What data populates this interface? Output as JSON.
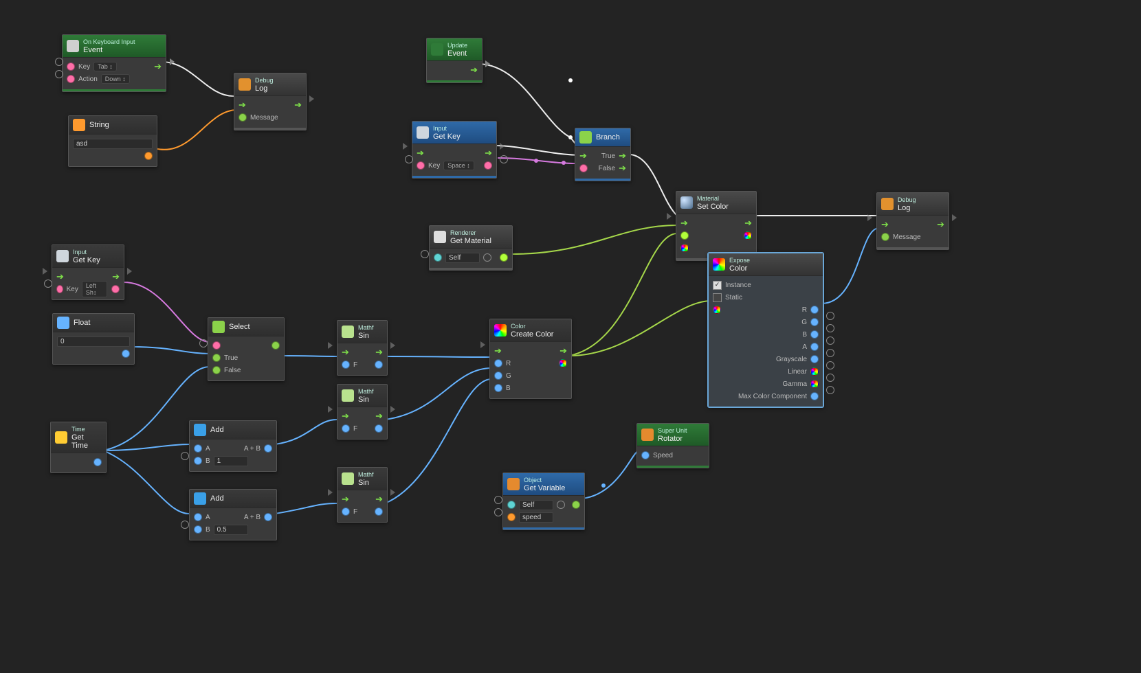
{
  "nodes": {
    "keyboardInput": {
      "sup": "On Keyboard Input",
      "title": "Event",
      "keyLabel": "Key",
      "keyVal": "Tab ↕",
      "actionLabel": "Action",
      "actionVal": "Down ↕"
    },
    "debug1": {
      "sup": "Debug",
      "title": "Log",
      "msg": "Message"
    },
    "string": {
      "title": "String",
      "val": "asd"
    },
    "update": {
      "sup": "Update",
      "title": "Event"
    },
    "getKey1": {
      "sup": "Input",
      "title": "Get Key",
      "keyLabel": "Key",
      "keyVal": "Space ↕"
    },
    "branch": {
      "title": "Branch",
      "t": "True",
      "f": "False"
    },
    "setColor": {
      "sup": "Material",
      "title": "Set Color"
    },
    "debug2": {
      "sup": "Debug",
      "title": "Log",
      "msg": "Message"
    },
    "renderer": {
      "sup": "Renderer",
      "title": "Get Material",
      "self": "Self"
    },
    "expose": {
      "sup": "Expose",
      "title": "Color",
      "instance": "Instance",
      "staticL": "Static",
      "outs": [
        "R",
        "G",
        "B",
        "A",
        "Grayscale",
        "Linear",
        "Gamma",
        "Max Color Component"
      ]
    },
    "getKey2": {
      "sup": "Input",
      "title": "Get Key",
      "keyLabel": "Key",
      "keyVal": "Left Sh↕"
    },
    "float": {
      "title": "Float",
      "val": "0"
    },
    "select": {
      "title": "Select",
      "t": "True",
      "f": "False"
    },
    "sin1": {
      "sup": "Mathf",
      "title": "Sin",
      "f": "F"
    },
    "sin2": {
      "sup": "Mathf",
      "title": "Sin",
      "f": "F"
    },
    "sin3": {
      "sup": "Mathf",
      "title": "Sin",
      "f": "F"
    },
    "createColor": {
      "sup": "Color",
      "title": "Create Color",
      "r": "R",
      "g": "G",
      "b": "B"
    },
    "time": {
      "sup": "Time",
      "title": "Get Time"
    },
    "add1": {
      "title": "Add",
      "a": "A",
      "b": "B",
      "bval": "1",
      "out": "A + B"
    },
    "add2": {
      "title": "Add",
      "a": "A",
      "b": "B",
      "bval": "0.5",
      "out": "A + B"
    },
    "getVar": {
      "sup": "Object",
      "title": "Get Variable",
      "self": "Self",
      "var": "speed"
    },
    "rotator": {
      "sup": "Super Unit",
      "title": "Rotator",
      "speed": "Speed"
    }
  }
}
